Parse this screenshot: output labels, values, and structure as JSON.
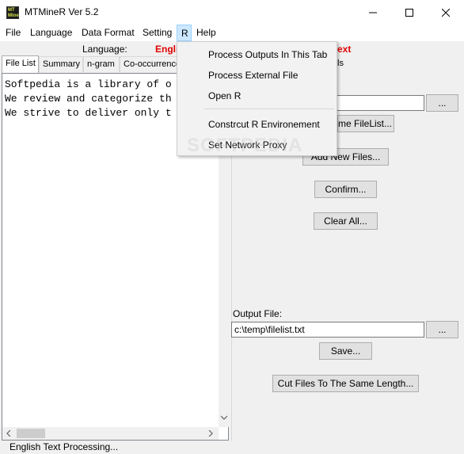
{
  "window": {
    "title": "MTMineR Ver 5.2",
    "icon_text": "MT Mine"
  },
  "menubar": {
    "items": [
      "File",
      "Language",
      "Data Format",
      "Setting",
      "R",
      "Help"
    ],
    "active": "R"
  },
  "language_row": {
    "label": "Language:",
    "value": "Engli",
    "value_tail": "ext"
  },
  "tabs": [
    "File List",
    "Summary",
    "n-gram",
    "Co-occurrence"
  ],
  "hidden_tab_tail": "ls",
  "editor": {
    "lines": [
      "Softpedia is a library of o",
      "We review and categorize th",
      "We strive to deliver only t"
    ]
  },
  "right_panel": {
    "browse_label": "...",
    "open_filelist_partial": "me FileList...",
    "add_new_files_partial": "Add New Files...",
    "confirm_label": "Confirm...",
    "clear_all_label": "Clear All...",
    "output_file_label": "Output File:",
    "output_file_value": "c:\\temp\\filelist.txt",
    "output_browse_label": "...",
    "save_label": "Save...",
    "cut_files_label": "Cut Files To The Same Length..."
  },
  "r_menu": {
    "items": [
      "Process Outputs In This Tab",
      "Process External File",
      "Open R",
      "Constrcut R Environement",
      "Set Network Proxy"
    ]
  },
  "watermark": "SOFTPEDIA",
  "status": {
    "text": "English Text Processing..."
  }
}
